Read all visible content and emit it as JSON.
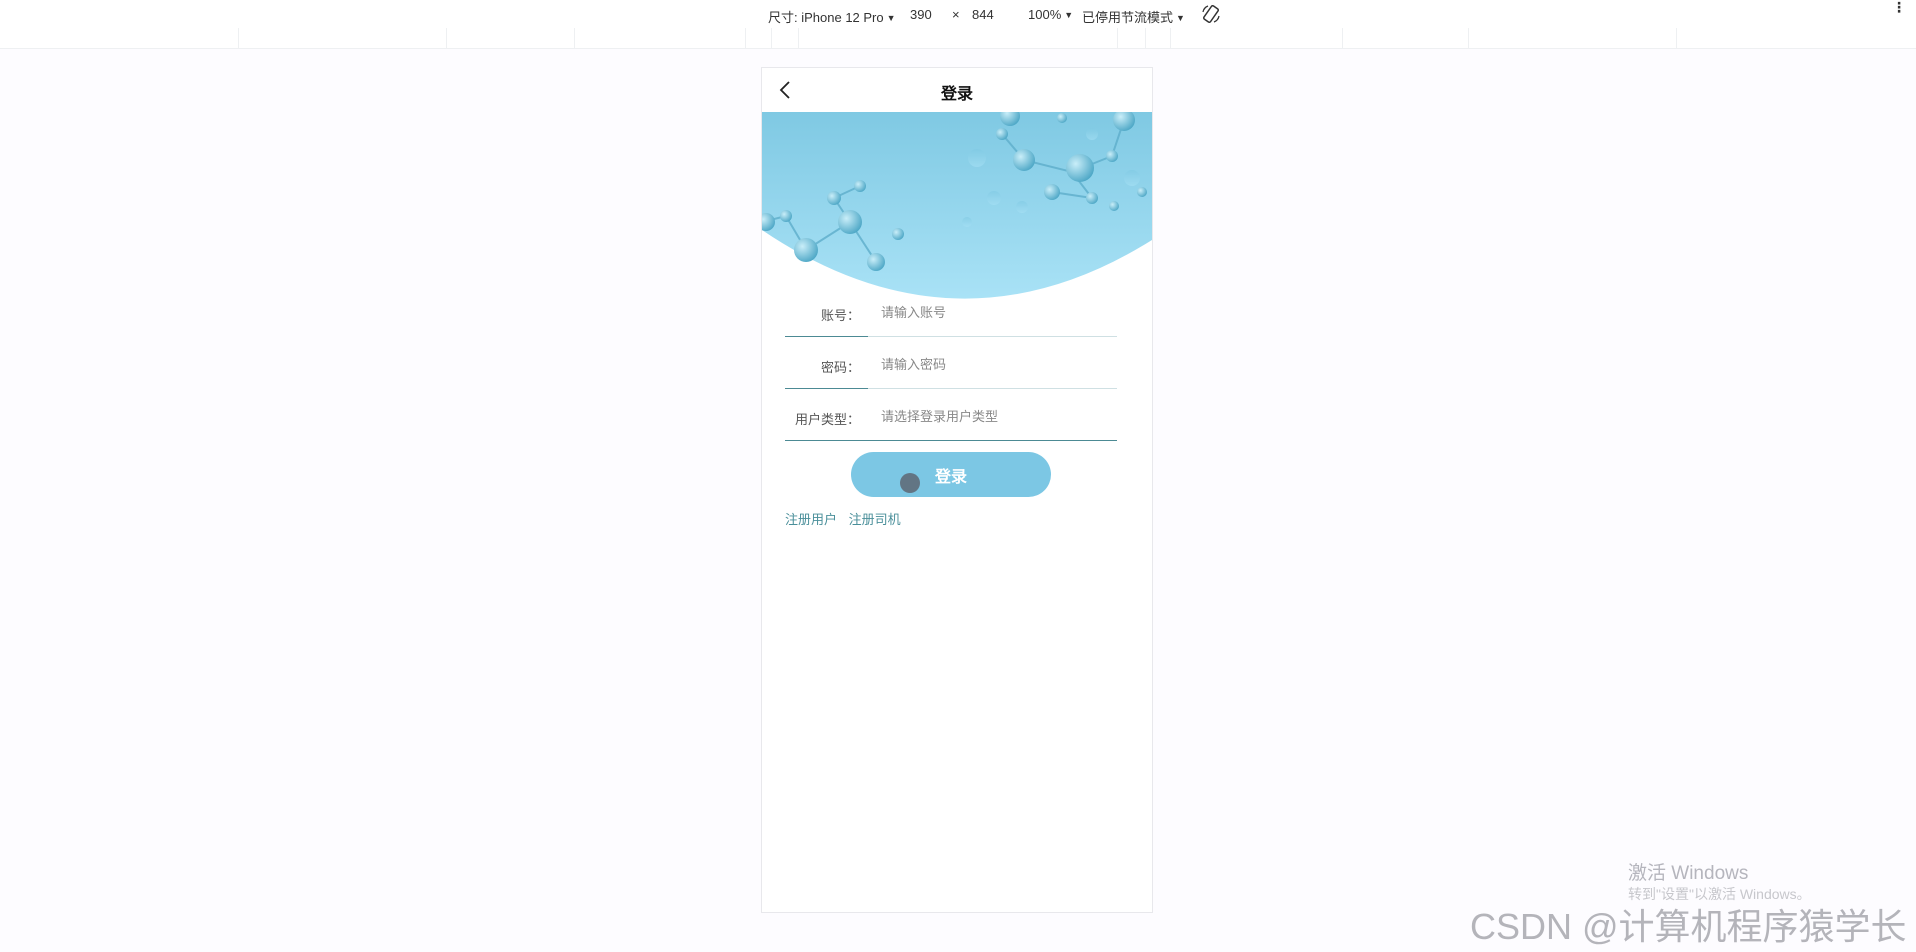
{
  "devtools": {
    "dimensions_label": "尺寸: iPhone 12 Pro",
    "width": "390",
    "times": "×",
    "height": "844",
    "zoom": "100%",
    "throttle": "已停用节流模式"
  },
  "page": {
    "title": "登录"
  },
  "form": {
    "account": {
      "label": "账号：",
      "placeholder": "请输入账号"
    },
    "password": {
      "label": "密码：",
      "placeholder": "请输入密码"
    },
    "user_type": {
      "label": "用户类型：",
      "placeholder": "请选择登录用户类型"
    }
  },
  "login_button": "登录",
  "links": {
    "register_user": "注册用户",
    "register_driver": "注册司机"
  },
  "watermarks": {
    "windows_title": "激活 Windows",
    "windows_sub": "转到\"设置\"以激活 Windows。",
    "csdn": "CSDN @计算机程序猿学长"
  },
  "colors": {
    "accent": "#7cc7e4",
    "link": "#4a8f9a",
    "underline": "#4c8a94",
    "banner_top": "#7fc9e3",
    "banner_bottom": "#a9e2f6"
  }
}
